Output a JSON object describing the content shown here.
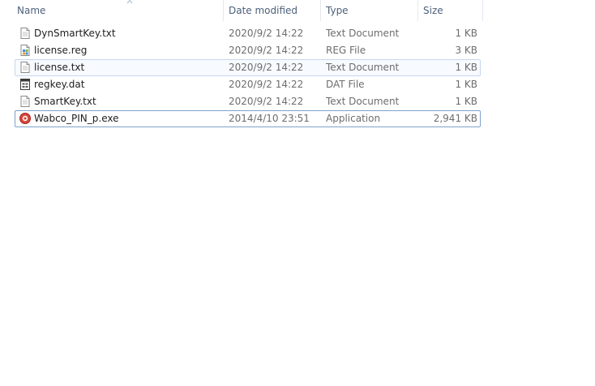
{
  "columns": {
    "name": "Name",
    "date": "Date modified",
    "type": "Type",
    "size": "Size"
  },
  "files": [
    {
      "name": "DynSmartKey.txt",
      "date": "2020/9/2 14:22",
      "type": "Text Document",
      "size": "1 KB",
      "icon": "text-file-icon"
    },
    {
      "name": "license.reg",
      "date": "2020/9/2 14:22",
      "type": "REG File",
      "size": "3 KB",
      "icon": "registry-file-icon"
    },
    {
      "name": "license.txt",
      "date": "2020/9/2 14:22",
      "type": "Text Document",
      "size": "1 KB",
      "icon": "text-file-icon"
    },
    {
      "name": "regkey.dat",
      "date": "2020/9/2 14:22",
      "type": "DAT File",
      "size": "1 KB",
      "icon": "data-file-icon"
    },
    {
      "name": "SmartKey.txt",
      "date": "2020/9/2 14:22",
      "type": "Text Document",
      "size": "1 KB",
      "icon": "text-file-icon"
    },
    {
      "name": "Wabco_PIN_p.exe",
      "date": "2014/4/10 23:51",
      "type": "Application",
      "size": "2,941 KB",
      "icon": "application-icon"
    }
  ],
  "colors": {
    "header_text": "#4c607a",
    "hover_border": "#c7d8ee",
    "focus_border": "#7da2ce",
    "app_icon": "#d9453a"
  }
}
